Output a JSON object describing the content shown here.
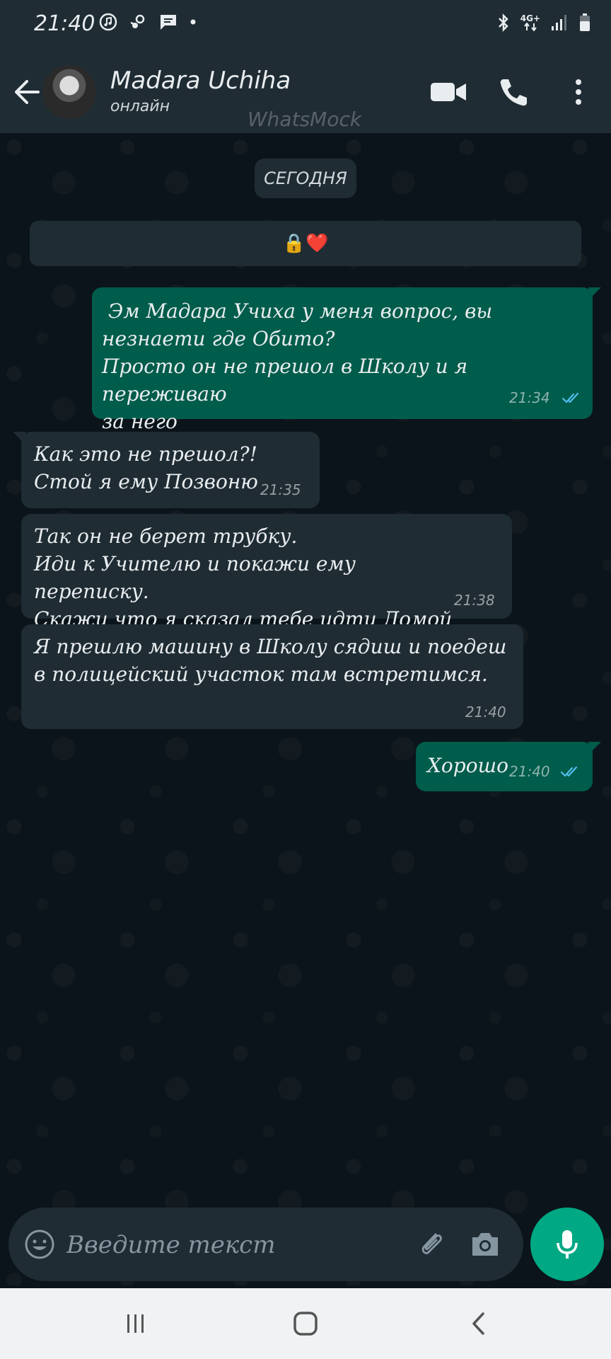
{
  "status_bar": {
    "time": "21:40",
    "network": "4G+",
    "left_icons": [
      "music-note-icon",
      "steam-icon",
      "message-icon",
      "dot-icon"
    ],
    "right_icons": [
      "bluetooth-icon",
      "network-arrows-icon",
      "signal-icon",
      "battery-icon"
    ]
  },
  "header": {
    "contact_name": "Madara Uchiha",
    "contact_status": "онлайн",
    "watermark": "WhatsMock",
    "icons": [
      "back-arrow-icon",
      "avatar",
      "video-call-icon",
      "phone-icon",
      "more-vert-icon"
    ]
  },
  "chat": {
    "date_label": "СЕГОДНЯ",
    "encryption_notice": "🔒❤️",
    "messages": [
      {
        "direction": "out",
        "text": " Эм Мадара Учиха у меня вопрос, вы\nнезнаети где Обито?\nПросто он не прешол в Школу и я переживаю\nза него",
        "time": "21:34",
        "read": true
      },
      {
        "direction": "in",
        "text": "Как это не прешол?!\nСтой я ему Позвоню",
        "time": "21:35"
      },
      {
        "direction": "in",
        "text": "Так он не берет трубку.\nИди к Учителю и покажи ему переписку.\nСкажи что я сказал тебе идти Домой",
        "time": "21:38"
      },
      {
        "direction": "in",
        "text": "Я прешлю машину в Школу сядиш и поедеш\nв полицейский участок там встретимся.",
        "time": "21:40"
      },
      {
        "direction": "out",
        "text": "Хорошо",
        "time": "21:40",
        "read": true
      }
    ],
    "colors": {
      "outgoing_bubble": "#005c4b",
      "incoming_bubble": "#1f2c34",
      "read_ticks": "#53bdeb"
    }
  },
  "input": {
    "placeholder": "Введите текст",
    "icons": [
      "emoji-icon",
      "attach-icon",
      "camera-icon",
      "mic-icon"
    ]
  },
  "nav_bar": {
    "icons": [
      "recents-icon",
      "home-icon",
      "back-icon"
    ]
  }
}
